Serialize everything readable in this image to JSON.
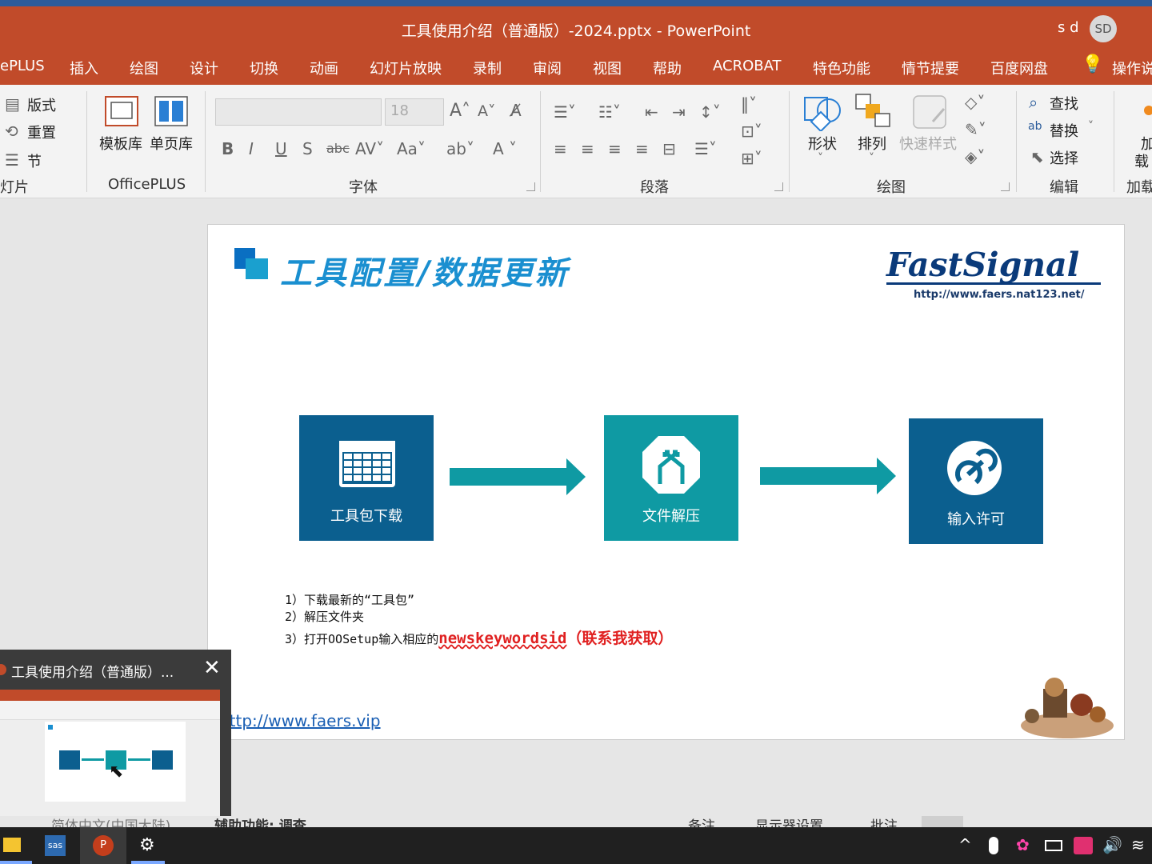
{
  "window": {
    "title": "工具使用介绍（普通版）-2024.pptx  -  PowerPoint",
    "user_name": "s d",
    "user_initials": "SD"
  },
  "menu": [
    "ePLUS",
    "插入",
    "绘图",
    "设计",
    "切换",
    "动画",
    "幻灯片放映",
    "录制",
    "审阅",
    "视图",
    "帮助",
    "ACROBAT",
    "特色功能",
    "情节提要",
    "百度网盘",
    "操作说"
  ],
  "ribbon": {
    "slides_group": {
      "layout": "版式",
      "reset": "重置",
      "section": "节",
      "label": "灯片"
    },
    "officeplus_group": {
      "template": "模板库",
      "single": "单页库",
      "label": "OfficePLUS"
    },
    "font_group": {
      "font_size": "18",
      "label": "字体"
    },
    "paragraph_group": {
      "label": "段落"
    },
    "drawing_group": {
      "shape": "形状",
      "arrange": "排列",
      "quick_style": "快速样式",
      "label": "绘图"
    },
    "editing_group": {
      "find": "查找",
      "replace": "替换",
      "select": "选择",
      "label": "编辑"
    },
    "addin_group": {
      "line1": "加",
      "line2": "载",
      "label": "加载"
    }
  },
  "slide": {
    "title": "工具配置/数据更新",
    "logo": "FastSignal",
    "logo_url": "http://www.faers.nat123.net/",
    "steps_boxes": [
      {
        "label": "工具包下载",
        "color": "#0b5f8f"
      },
      {
        "label": "文件解压",
        "color": "#0f9aa3"
      },
      {
        "label": "输入许可",
        "color": "#0b5f8f"
      }
    ],
    "arrow_color": "#0f9aa3",
    "instructions": [
      "1）下载最新的“工具包”",
      "2）解压文件夹",
      "3）打开OOSetup输入相应的"
    ],
    "highlight_code": "newskeywordsid",
    "highlight_note": "（联系我获取）",
    "footer_link": "http://www.faers.vip"
  },
  "preview": {
    "title": "工具使用介绍（普通版）..."
  },
  "statusbar": {
    "language": "简体中文(中国大陆)",
    "accessibility": "辅助功能: 调查",
    "notes": "备注",
    "display": "显示器设置",
    "comments": "批注"
  },
  "taskbar": {
    "apps": [
      "file-explorer",
      "sas",
      "powerpoint",
      "settings"
    ]
  }
}
